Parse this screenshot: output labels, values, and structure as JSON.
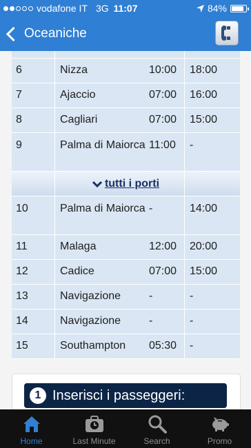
{
  "status_bar": {
    "carrier": "vodafone IT",
    "network": "3G",
    "time": "11:07",
    "battery": "84%",
    "battery_level": 0.84
  },
  "nav": {
    "back_label": "Oceaniche",
    "phone_icon": "phone-icon"
  },
  "table": {
    "rows": [
      {
        "num": "6",
        "port": "Nizza",
        "arrival": "10:00",
        "departure": "18:00"
      },
      {
        "num": "7",
        "port": "Ajaccio",
        "arrival": "07:00",
        "departure": "16:00"
      },
      {
        "num": "8",
        "port": "Cagliari",
        "arrival": "07:00",
        "departure": "15:00"
      },
      {
        "num": "9",
        "port": "Palma di Maiorca",
        "arrival": "11:00",
        "departure": "-"
      },
      {
        "num": "10",
        "port": "Palma di Maiorca",
        "arrival": "-",
        "departure": "14:00"
      },
      {
        "num": "11",
        "port": "Malaga",
        "arrival": "12:00",
        "departure": "20:00"
      },
      {
        "num": "12",
        "port": "Cadice",
        "arrival": "07:00",
        "departure": "15:00"
      },
      {
        "num": "13",
        "port": "Navigazione",
        "arrival": "-",
        "departure": "-"
      },
      {
        "num": "14",
        "port": "Navigazione",
        "arrival": "-",
        "departure": "-"
      },
      {
        "num": "15",
        "port": "Southampton",
        "arrival": "05:30",
        "departure": "-"
      }
    ],
    "all_ports_label": "tutti i porti"
  },
  "passengers": {
    "step": "1",
    "title": "Inserisci i passeggeri:"
  },
  "tabs": [
    {
      "label": "Home",
      "icon": "home-icon",
      "active": true
    },
    {
      "label": "Last Minute",
      "icon": "suitcase-clock-icon",
      "active": false
    },
    {
      "label": "Search",
      "icon": "search-icon",
      "active": false
    },
    {
      "label": "Promo",
      "icon": "piggy-bank-icon",
      "active": false
    }
  ],
  "colors": {
    "accent": "#2f7fd4",
    "table_bg": "#dae6f3",
    "header_dark": "#0c2546",
    "tab_bar": "#111111"
  }
}
